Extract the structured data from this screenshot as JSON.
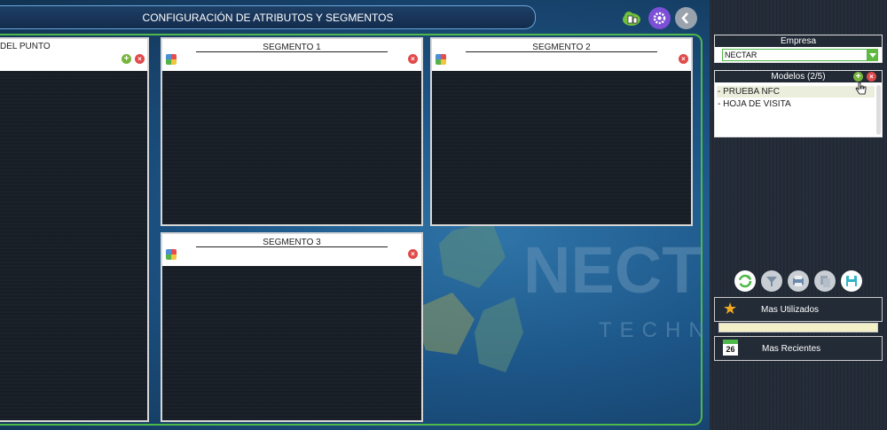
{
  "header": {
    "title": "CONFIGURACIÓN DE ATRIBUTOS Y SEGMENTOS",
    "icons": [
      "cloud-devices-icon",
      "settings-icon",
      "back-arrow-icon"
    ]
  },
  "segments": {
    "point": {
      "title": "DEL PUNTO"
    },
    "seg1": {
      "title": "SEGMENTO 1"
    },
    "seg2": {
      "title": "SEGMENTO 2"
    },
    "seg3": {
      "title": "SEGMENTO 3"
    }
  },
  "watermark": {
    "text_1": "NECT",
    "text_2": "TECHNO"
  },
  "sidebar": {
    "empresa": {
      "label": "Empresa",
      "value": "NECTAR"
    },
    "modelos": {
      "label": "Modelos (2/5)",
      "items": [
        "- PRUEBA NFC",
        "- HOJA DE VISITA"
      ]
    },
    "toolbar_icons": [
      "refresh-icon",
      "filter-icon",
      "print-icon",
      "copy-icon",
      "save-icon"
    ],
    "mas_utilizados": "Mas Utilizados",
    "mas_recientes": "Mas Recientes",
    "calendar_day": "26"
  },
  "colors": {
    "accent_green": "#4fb84a",
    "title_bg": "#1e3f66",
    "settings_purple": "#7b4fd6"
  }
}
